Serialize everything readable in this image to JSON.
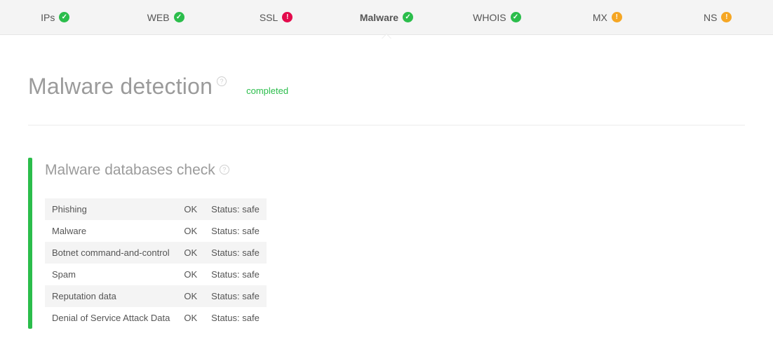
{
  "tabs": [
    {
      "label": "IPs",
      "status": "ok",
      "active": false
    },
    {
      "label": "WEB",
      "status": "ok",
      "active": false
    },
    {
      "label": "SSL",
      "status": "error",
      "active": false
    },
    {
      "label": "Malware",
      "status": "ok",
      "active": true
    },
    {
      "label": "WHOIS",
      "status": "ok",
      "active": false
    },
    {
      "label": "MX",
      "status": "warn",
      "active": false
    },
    {
      "label": "NS",
      "status": "warn",
      "active": false
    }
  ],
  "headline": {
    "title": "Malware detection",
    "badge": "completed"
  },
  "section": {
    "title": "Malware databases check",
    "rows": [
      {
        "name": "Phishing",
        "result": "OK",
        "status": "Status: safe"
      },
      {
        "name": "Malware",
        "result": "OK",
        "status": "Status: safe"
      },
      {
        "name": "Botnet command-and-control",
        "result": "OK",
        "status": "Status: safe"
      },
      {
        "name": "Spam",
        "result": "OK",
        "status": "Status: safe"
      },
      {
        "name": "Reputation data",
        "result": "OK",
        "status": "Status: safe"
      },
      {
        "name": "Denial of Service Attack Data",
        "result": "OK",
        "status": "Status: safe"
      }
    ]
  },
  "status_glyphs": {
    "ok": "✓",
    "error": "!",
    "warn": "!"
  },
  "status_classes": {
    "ok": "status-ok",
    "error": "status-error",
    "warn": "status-warn"
  },
  "colors": {
    "accent_green": "#2bbd4b",
    "error_red": "#e30b4c",
    "warn_orange": "#f5a623",
    "muted_text": "#9b9b9b"
  }
}
